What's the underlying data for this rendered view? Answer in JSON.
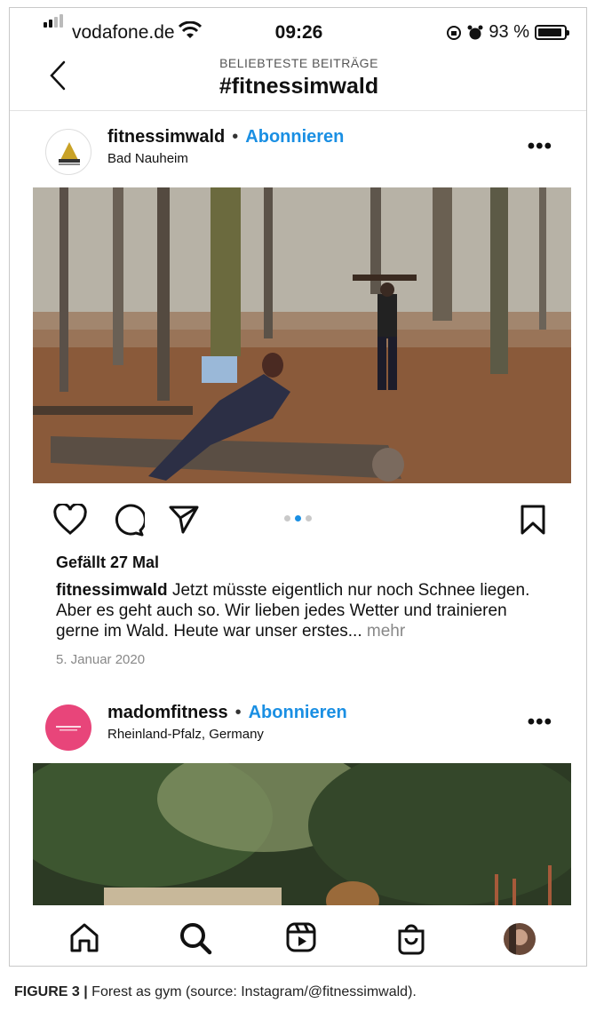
{
  "status_bar": {
    "carrier": "vodafone.de",
    "time": "09:26",
    "battery": "93 %",
    "battery_level": 0.93
  },
  "nav": {
    "subtitle": "BELIEBTESTE BEITRÄGE",
    "title": "#fitnessimwald"
  },
  "posts": [
    {
      "username": "fitnessimwald",
      "separator": "•",
      "follow": "Abonnieren",
      "location": "Bad Nauheim",
      "more": "•••",
      "likes": "Gefällt 27 Mal",
      "caption_user": "fitnessimwald",
      "caption_text": "Jetzt müsste eigentlich nur noch Schnee liegen. Aber es geht auch so. Wir lieben jedes Wetter und trainieren gerne im Wald. Heute war unser erstes...",
      "more_link": "mehr",
      "date": "5. Januar 2020"
    },
    {
      "username": "madomfitness",
      "separator": "•",
      "follow": "Abonnieren",
      "location": "Rheinland-Pfalz, Germany",
      "more": "•••"
    }
  ],
  "colors": {
    "accent": "#1a8fe3",
    "avatar2": "#e8457a"
  },
  "figure_caption": {
    "label": "FIGURE 3 |",
    "text": "Forest as gym (source: Instagram/@fitnessimwald)."
  }
}
